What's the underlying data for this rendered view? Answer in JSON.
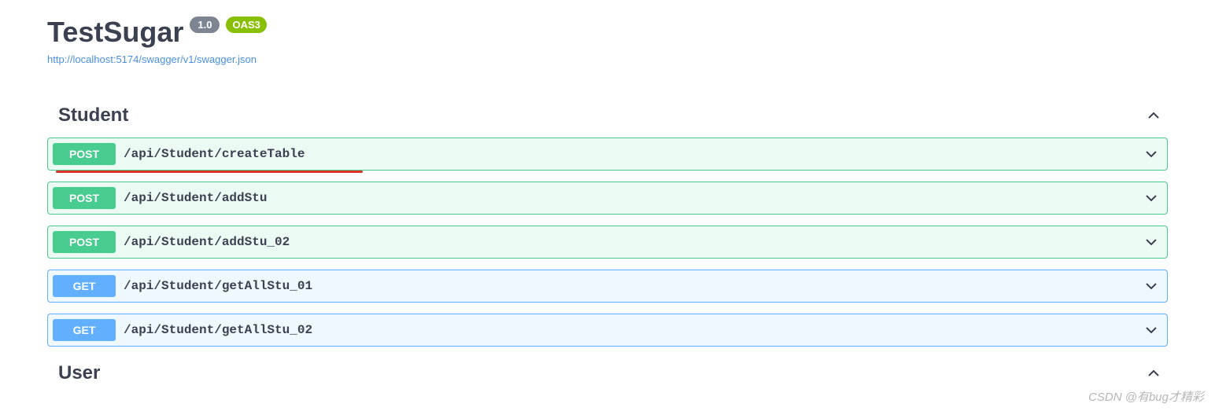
{
  "header": {
    "title": "TestSugar",
    "version": "1.0",
    "oas": "OAS3",
    "swagger_url": "http://localhost:5174/swagger/v1/swagger.json"
  },
  "tags": [
    {
      "name": "Student",
      "expanded": true,
      "operations": [
        {
          "method": "POST",
          "path": "/api/Student/createTable",
          "annotated": true
        },
        {
          "method": "POST",
          "path": "/api/Student/addStu",
          "annotated": false
        },
        {
          "method": "POST",
          "path": "/api/Student/addStu_02",
          "annotated": false
        },
        {
          "method": "GET",
          "path": "/api/Student/getAllStu_01",
          "annotated": false
        },
        {
          "method": "GET",
          "path": "/api/Student/getAllStu_02",
          "annotated": false
        }
      ]
    },
    {
      "name": "User",
      "expanded": true,
      "operations": []
    }
  ],
  "colors": {
    "post": "#49cc90",
    "get": "#61affe",
    "oas_badge": "#89bf04",
    "version_badge": "#7d8492",
    "link": "#4990e2"
  },
  "watermark": "CSDN @有bug才精彩"
}
